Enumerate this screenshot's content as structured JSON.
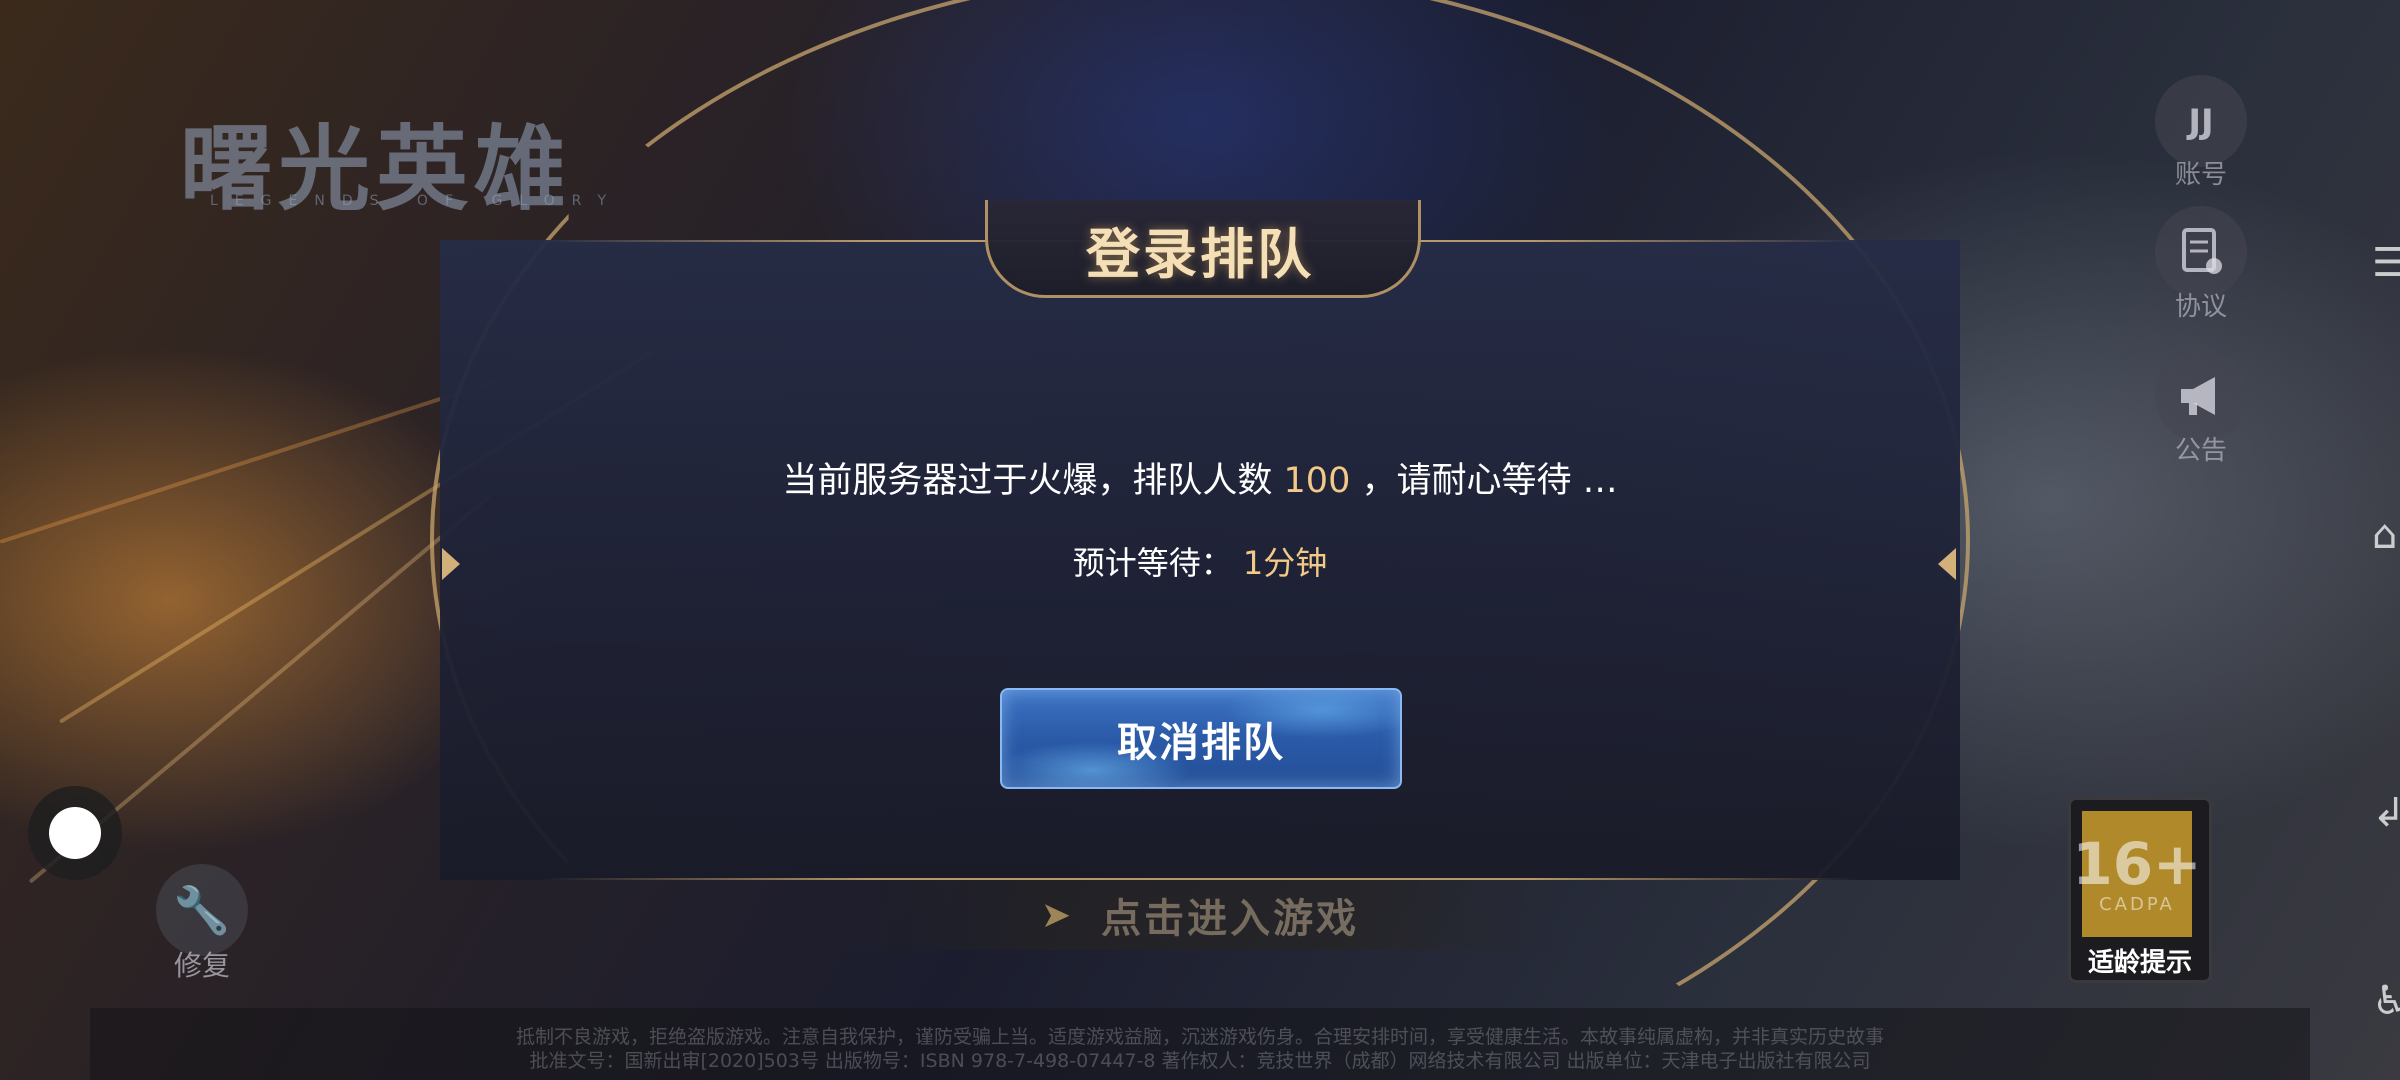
{
  "game": {
    "logo_text": "曙光英雄",
    "logo_subtitle": "LEGENDS OF GLORY"
  },
  "dialog": {
    "title": "登录排队",
    "message_prefix": "当前服务器过于火爆，排队人数",
    "queue_count": "100",
    "message_suffix": "，请耐心等待 …",
    "wait_label": "预计等待：",
    "wait_value": "1分钟",
    "cancel_button": "取消排队"
  },
  "enter_game": {
    "label": "点击进入游戏"
  },
  "side_menu": {
    "account": {
      "label": "账号",
      "icon": "account-icon"
    },
    "agreement": {
      "label": "协议",
      "icon": "agreement-icon"
    },
    "announcement": {
      "label": "公告",
      "icon": "megaphone-icon"
    }
  },
  "repair": {
    "label": "修复",
    "icon": "wrench-icon"
  },
  "age_rating": {
    "age": "16+",
    "org": "CADPA",
    "tip": "适龄提示"
  },
  "footer": {
    "line1": "抵制不良游戏，拒绝盗版游戏。注意自我保护，谨防受骗上当。适度游戏益脑，沉迷游戏伤身。合理安排时间，享受健康生活。本故事纯属虚构，并非真实历史故事",
    "line2": "批准文号：国新出审[2020]503号  出版物号：ISBN 978-7-498-07447-8  著作权人：竞技世界（成都）网络技术有限公司  出版单位：天津电子出版社有限公司"
  },
  "colors": {
    "accent_gold": "#f3c987",
    "title_gold": "#f4dfb6",
    "button_blue": "#2a5aa8",
    "frame_gold": "#c8a56e"
  }
}
